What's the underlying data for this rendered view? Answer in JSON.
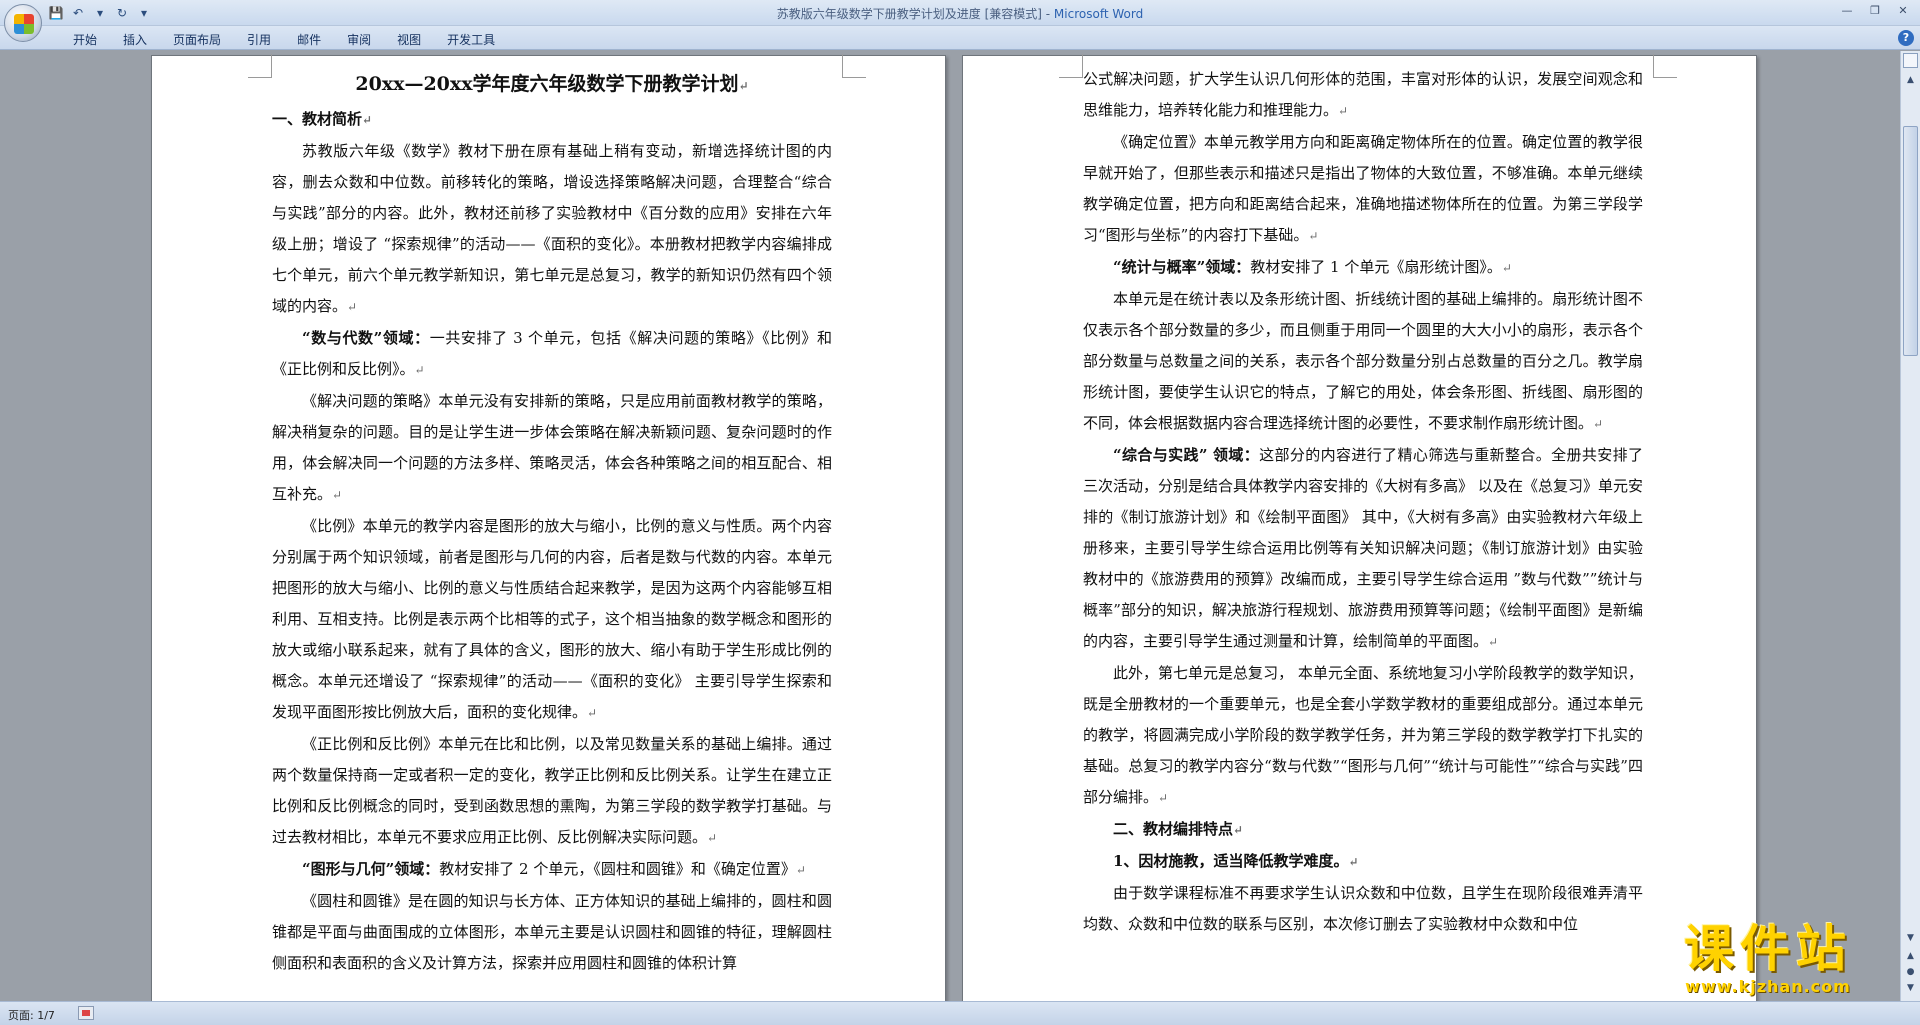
{
  "window": {
    "title_doc": "苏教版六年级数学下册教学计划及进度 [兼容模式] - ",
    "title_app": "Microsoft Word"
  },
  "ribbon": {
    "tabs": [
      "开始",
      "插入",
      "页面布局",
      "引用",
      "邮件",
      "审阅",
      "视图",
      "开发工具"
    ]
  },
  "status": {
    "page_info": "页面: 1/7"
  },
  "watermark": {
    "text": "课件站",
    "url": "www.kjzhan.com"
  },
  "page1": {
    "title": "20xx—20xx学年度六年级数学下册教学计划",
    "heading1": "一、教材简析",
    "p1": "苏教版六年级《数学》教材下册在原有基础上稍有变动，新增选择统计图的内容，删去众数和中位数。前移转化的策略，增设选择策略解决问题，合理整合“综合与实践”部分的内容。此外，教材还前移了实验教材中《百分数的应用》安排在六年级上册；增设了 “探索规律”的活动——《面积的变化》。本册教材把教学内容编排成七个单元，前六个单元教学新知识，第七单元是总复习，教学的新知识仍然有四个领域的内容。",
    "p2_bold": "“数与代数”领域：",
    "p2_rest": "一共安排了 3 个单元，包括《解决问题的策略》《比例》和《正比例和反比例》。",
    "p3": "《解决问题的策略》本单元没有安排新的策略，只是应用前面教材教学的策略，解决稍复杂的问题。目的是让学生进一步体会策略在解决新颖问题、复杂问题时的作用，体会解决同一个问题的方法多样、策略灵活，体会各种策略之间的相互配合、相互补充。",
    "p4": "《比例》本单元的教学内容是图形的放大与缩小，比例的意义与性质。两个内容分别属于两个知识领域，前者是图形与几何的内容，后者是数与代数的内容。本单元把图形的放大与缩小、比例的意义与性质结合起来教学，是因为这两个内容能够互相利用、互相支持。比例是表示两个比相等的式子，这个相当抽象的数学概念和图形的放大或缩小联系起来，就有了具体的含义，图形的放大、缩小有助于学生形成比例的概念。本单元还增设了 “探索规律”的活动——《面积的变化》 主要引导学生探索和发现平面图形按比例放大后，面积的变化规律。",
    "p5": "《正比例和反比例》本单元在比和比例，以及常见数量关系的基础上编排。通过两个数量保持商一定或者积一定的变化，教学正比例和反比例关系。让学生在建立正比例和反比例概念的同时，受到函数思想的熏陶，为第三学段的数学教学打基础。与过去教材相比，本单元不要求应用正比例、反比例解决实际问题。",
    "p6_bold": "“图形与几何”领域：",
    "p6_rest": "教材安排了 2 个单元，《圆柱和圆锥》和《确定位置》",
    "p7": "《圆柱和圆锥》是在圆的知识与长方体、正方体知识的基础上编排的，圆柱和圆锥都是平面与曲面围成的立体图形，本单元主要是认识圆柱和圆锥的特征，理解圆柱侧面积和表面积的含义及计算方法，探索并应用圆柱和圆锥的体积计算"
  },
  "page2": {
    "p1": "公式解决问题，扩大学生认识几何形体的范围，丰富对形体的认识，发展空间观念和思维能力，培养转化能力和推理能力。",
    "p2": "《确定位置》本单元教学用方向和距离确定物体所在的位置。确定位置的教学很早就开始了，但那些表示和描述只是指出了物体的大致位置，不够准确。本单元继续教学确定位置，把方向和距离结合起来，准确地描述物体所在的位置。为第三学段学习“图形与坐标”的内容打下基础。",
    "p3_bold": "“统计与概率”领域：",
    "p3_rest": "教材安排了 1 个单元《扇形统计图》。",
    "p4": "本单元是在统计表以及条形统计图、折线统计图的基础上编排的。扇形统计图不仅表示各个部分数量的多少，而且侧重于用同一个圆里的大大小小的扇形，表示各个部分数量与总数量之间的关系，表示各个部分数量分别占总数量的百分之几。教学扇形统计图，要使学生认识它的特点，了解它的用处，体会条形图、折线图、扇形图的不同，体会根据数据内容合理选择统计图的必要性，不要求制作扇形统计图。",
    "p5_bold": "“综合与实践” 领域：",
    "p5_rest": "这部分的内容进行了精心筛选与重新整合。全册共安排了三次活动，分别是结合具体教学内容安排的《大树有多高》 以及在《总复习》单元安排的《制订旅游计划》和《绘制平面图》 其中，《大树有多高》由实验教材六年级上册移来，主要引导学生综合运用比例等有关知识解决问题；《制订旅游计划》由实验教材中的《旅游费用的预算》改编而成，主要引导学生综合运用 ”数与代数””统计与概率”部分的知识，解决旅游行程规划、旅游费用预算等问题；《绘制平面图》是新编的内容，主要引导学生通过测量和计算，绘制简单的平面图。",
    "p6": "此外，第七单元是总复习， 本单元全面、系统地复习小学阶段教学的数学知识，既是全册教材的一个重要单元，也是全套小学数学教材的重要组成部分。通过本单元的教学，将圆满完成小学阶段的数学教学任务，并为第三学段的数学教学打下扎实的基础。总复习的教学内容分“数与代数”“图形与几何”“统计与可能性”“综合与实践”四部分编排。",
    "heading2": "二、教材编排特点",
    "heading3": "1、因材施教，适当降低教学难度。",
    "p7": "由于数学课程标准不再要求学生认识众数和中位数，且学生在现阶段很难弄清平均数、众数和中位数的联系与区别，本次修订删去了实验教材中众数和中位"
  }
}
